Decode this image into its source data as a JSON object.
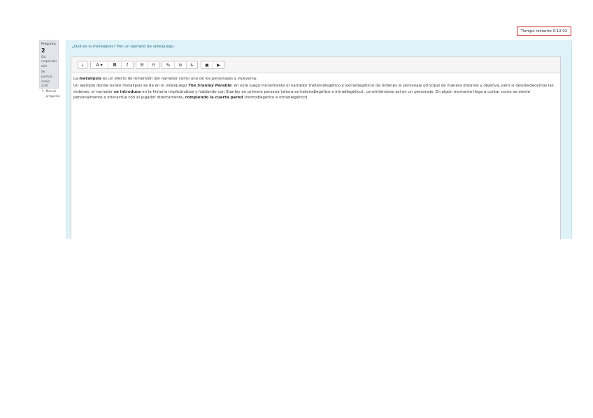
{
  "timer": {
    "label": "Tiempo restante 0:12:02"
  },
  "question_info": {
    "question_prefix": "Pregunta",
    "question_number": "2",
    "status": "Sin responder aún",
    "grade": "Se puntúa como 2,00",
    "flag_label": "Marcar pregunta",
    "flag_icon": "flag-icon"
  },
  "question": {
    "text": "¿Qué es la metalepsis? Pon un ejemplo de videojuego."
  },
  "toolbar": {
    "buttons": [
      {
        "name": "collapse-toggle-button",
        "glyph": "⇣",
        "icon": "toggle-icon"
      },
      {
        "name": "font-color-button",
        "glyph": "A ▾",
        "icon": "font-color-icon"
      },
      {
        "name": "bold-button",
        "glyph": "B",
        "icon": "bold-icon"
      },
      {
        "name": "italic-button",
        "glyph": "I",
        "icon": "italic-icon"
      },
      {
        "name": "unordered-list-button",
        "glyph": "☰",
        "icon": "unordered-list-icon"
      },
      {
        "name": "ordered-list-button",
        "glyph": "☷",
        "icon": "ordered-list-icon"
      },
      {
        "name": "link-button",
        "glyph": "%",
        "icon": "link-icon"
      },
      {
        "name": "unlink-button",
        "glyph": "⊘",
        "icon": "unlink-icon"
      },
      {
        "name": "accessibility-button",
        "glyph": "♿",
        "icon": "accessibility-icon"
      },
      {
        "name": "insert-image-button",
        "glyph": "▣",
        "icon": "image-icon"
      },
      {
        "name": "insert-media-button",
        "glyph": "▶",
        "icon": "media-icon"
      }
    ]
  },
  "answer": {
    "p1": {
      "t1": "La ",
      "b1": "metalipsis",
      "t2": " es un efecto de inmersión del narrador como uno de los personajes y viceversa."
    },
    "p2": {
      "t1": "Un ejemplo donde existe metalipsis se da en el videojuego ",
      "bi1": "The Stanley Parable",
      "t2": "; en este juego inicialmente el narrador (heterodiegético y extradiegético) da órdenes al personaje principal de manera distante y objetiva, pero si desobedecemos las órdenes, el narrador ",
      "b1": "se introduce",
      "t3": " en la historia implicándose y hablando con Stanley en primera persona (ahora es heterodiegético e intradiegético), convirtiéndose así en un personaje. En algún momento llega a contar como se siente personalmente e interactúa con el jugador directamente, ",
      "b2": "rompiendo la cuarta pared",
      "t4": " (homodiegético e intradiegético)."
    }
  }
}
